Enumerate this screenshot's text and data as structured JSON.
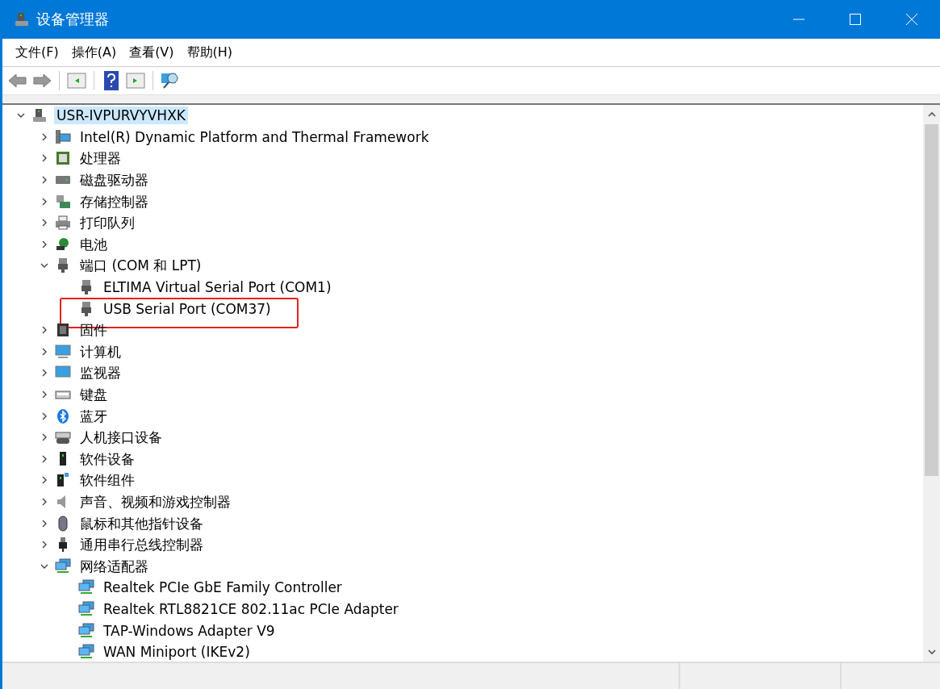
{
  "window": {
    "title": "设备管理器"
  },
  "menu": [
    "文件(F)",
    "操作(A)",
    "查看(V)",
    "帮助(H)"
  ],
  "tree": {
    "label": "USR-IVPURVYVHXK",
    "expanded": true,
    "selected": true,
    "highlighted": false,
    "children": [
      {
        "label": "Intel(R) Dynamic Platform and Thermal Framework",
        "expanded": false,
        "selected": false,
        "highlighted": false
      },
      {
        "label": "处理器",
        "expanded": false,
        "selected": false,
        "highlighted": false
      },
      {
        "label": "磁盘驱动器",
        "expanded": false,
        "selected": false,
        "highlighted": false
      },
      {
        "label": "存储控制器",
        "expanded": false,
        "selected": false,
        "highlighted": false
      },
      {
        "label": "打印队列",
        "expanded": false,
        "selected": false,
        "highlighted": false
      },
      {
        "label": "电池",
        "expanded": false,
        "selected": false,
        "highlighted": false
      },
      {
        "label": "端口 (COM 和 LPT)",
        "expanded": true,
        "selected": false,
        "highlighted": false,
        "children": [
          {
            "label": "ELTIMA Virtual Serial Port (COM1)",
            "selected": false,
            "highlighted": false
          },
          {
            "label": "USB Serial Port (COM37)",
            "selected": false,
            "highlighted": true
          }
        ]
      },
      {
        "label": "固件",
        "expanded": false,
        "selected": false,
        "highlighted": false
      },
      {
        "label": "计算机",
        "expanded": false,
        "selected": false,
        "highlighted": false
      },
      {
        "label": "监视器",
        "expanded": false,
        "selected": false,
        "highlighted": false
      },
      {
        "label": "键盘",
        "expanded": false,
        "selected": false,
        "highlighted": false
      },
      {
        "label": "蓝牙",
        "expanded": false,
        "selected": false,
        "highlighted": false
      },
      {
        "label": "人机接口设备",
        "expanded": false,
        "selected": false,
        "highlighted": false
      },
      {
        "label": "软件设备",
        "expanded": false,
        "selected": false,
        "highlighted": false
      },
      {
        "label": "软件组件",
        "expanded": false,
        "selected": false,
        "highlighted": false
      },
      {
        "label": "声音、视频和游戏控制器",
        "expanded": false,
        "selected": false,
        "highlighted": false
      },
      {
        "label": "鼠标和其他指针设备",
        "expanded": false,
        "selected": false,
        "highlighted": false
      },
      {
        "label": "通用串行总线控制器",
        "expanded": false,
        "selected": false,
        "highlighted": false
      },
      {
        "label": "网络适配器",
        "expanded": true,
        "selected": false,
        "highlighted": false,
        "children": [
          {
            "label": "Realtek PCIe GbE Family Controller",
            "selected": false,
            "highlighted": false
          },
          {
            "label": "Realtek RTL8821CE 802.11ac PCIe Adapter",
            "selected": false,
            "highlighted": false
          },
          {
            "label": "TAP-Windows Adapter V9",
            "selected": false,
            "highlighted": false
          },
          {
            "label": "WAN Miniport (IKEv2)",
            "selected": false,
            "highlighted": false
          }
        ]
      }
    ]
  }
}
